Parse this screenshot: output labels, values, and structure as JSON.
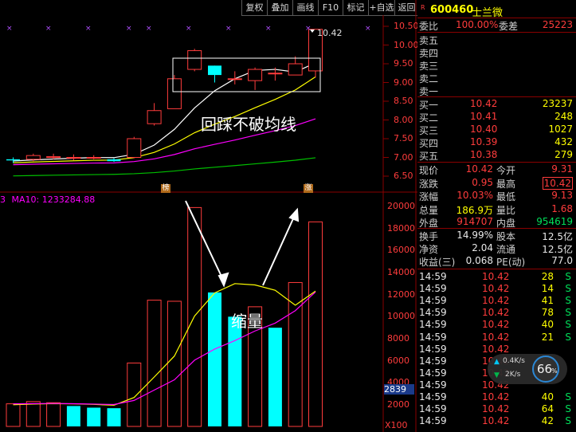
{
  "toolbar": {
    "buttons": [
      "复权",
      "叠加",
      "画线",
      "F10",
      "标记",
      "+自选",
      "返回"
    ],
    "close_icon": "close-icon"
  },
  "chart": {
    "price_axis": [
      "10.50",
      "10.00",
      "9.50",
      "9.00",
      "8.50",
      "8.00",
      "7.50",
      "7.00",
      "6.50"
    ],
    "last_price_label": "10.42",
    "annotation_top": "回踩不破均线",
    "badge_left": "榜",
    "badge_right": "涨",
    "ma_label": "MA10: 1233284.88",
    "ma_prefix": "3",
    "volume_axis": [
      "20000",
      "18000",
      "16000",
      "14000",
      "12000",
      "10000",
      "8000",
      "6000",
      "4000",
      "2000"
    ],
    "volume_marker": "2839",
    "volume_unit": "X100",
    "annotation_volume": "缩量"
  },
  "chart_data": {
    "type": "candlestick",
    "candles": [
      {
        "o": 6.95,
        "c": 6.92,
        "h": 7.0,
        "l": 6.85
      },
      {
        "o": 6.95,
        "c": 7.05,
        "h": 7.1,
        "l": 6.9
      },
      {
        "o": 7.02,
        "c": 7.02,
        "h": 7.1,
        "l": 6.95
      },
      {
        "o": 7.0,
        "c": 7.0,
        "h": 7.08,
        "l": 6.92
      },
      {
        "o": 7.0,
        "c": 7.0,
        "h": 7.06,
        "l": 6.95
      },
      {
        "o": 6.95,
        "c": 6.9,
        "h": 6.98,
        "l": 6.88
      },
      {
        "o": 7.0,
        "c": 7.5,
        "h": 7.55,
        "l": 6.98
      },
      {
        "o": 7.9,
        "c": 8.25,
        "h": 8.45,
        "l": 7.85
      },
      {
        "o": 8.3,
        "c": 9.1,
        "h": 9.2,
        "l": 8.3
      },
      {
        "o": 9.35,
        "c": 9.85,
        "h": 9.9,
        "l": 9.3
      },
      {
        "o": 9.45,
        "c": 9.2,
        "h": 9.45,
        "l": 9.0
      },
      {
        "o": 9.1,
        "c": 9.1,
        "h": 9.3,
        "l": 8.95
      },
      {
        "o": 9.05,
        "c": 9.35,
        "h": 9.4,
        "l": 8.8
      },
      {
        "o": 9.25,
        "c": 9.25,
        "h": 9.4,
        "l": 9.05
      },
      {
        "o": 9.2,
        "c": 9.5,
        "h": 9.7,
        "l": 9.2
      },
      {
        "o": 9.31,
        "c": 10.42,
        "h": 10.42,
        "l": 9.13
      }
    ],
    "volumes": [
      2100,
      2300,
      2200,
      1900,
      1750,
      1700,
      5800,
      11500,
      11400,
      19900,
      12200,
      10000,
      10900,
      9000,
      13100,
      18600
    ],
    "volume_up": [
      true,
      true,
      true,
      false,
      false,
      false,
      true,
      true,
      true,
      true,
      false,
      false,
      true,
      false,
      true,
      true
    ]
  },
  "quote": {
    "code_badge": "R",
    "code": "600460",
    "name": "士兰微",
    "weibi_label": "委比",
    "weibi": "100.00%",
    "weicha_label": "委差",
    "weicha": "25223",
    "sells": [
      "卖五",
      "卖四",
      "卖三",
      "卖二",
      "卖一"
    ],
    "buys": [
      {
        "label": "买一",
        "price": "10.42",
        "vol": "23237"
      },
      {
        "label": "买二",
        "price": "10.41",
        "vol": "248"
      },
      {
        "label": "买三",
        "price": "10.40",
        "vol": "1027"
      },
      {
        "label": "买四",
        "price": "10.39",
        "vol": "432"
      },
      {
        "label": "买五",
        "price": "10.38",
        "vol": "279"
      }
    ],
    "stats": [
      {
        "l1": "现价",
        "v1": "10.42",
        "l2": "今开",
        "v2": "9.31",
        "c1": "red",
        "c2": "red"
      },
      {
        "l1": "涨跌",
        "v1": "0.95",
        "l2": "最高",
        "v2": "10.42",
        "c1": "red",
        "c2": "red"
      },
      {
        "l1": "涨幅",
        "v1": "10.03%",
        "l2": "最低",
        "v2": "9.13",
        "c1": "red",
        "c2": "red"
      },
      {
        "l1": "总量",
        "v1": "186.9万",
        "l2": "量比",
        "v2": "1.68",
        "c1": "yel",
        "c2": "red"
      },
      {
        "l1": "外盘",
        "v1": "914707",
        "l2": "内盘",
        "v2": "954619",
        "c1": "red",
        "c2": "grn"
      }
    ],
    "stats2": [
      {
        "l1": "换手",
        "v1": "14.99%",
        "l2": "股本",
        "v2": "12.5亿"
      },
      {
        "l1": "净资",
        "v1": "2.04",
        "l2": "流通",
        "v2": "12.5亿"
      },
      {
        "l1": "收益(三)",
        "v1": "0.068",
        "l2": "PE(动)",
        "v2": "77.0"
      }
    ]
  },
  "ticks": [
    {
      "t": "14:59",
      "p": "10.42",
      "v": "28",
      "d": "S"
    },
    {
      "t": "14:59",
      "p": "10.42",
      "v": "14",
      "d": "S"
    },
    {
      "t": "14:59",
      "p": "10.42",
      "v": "41",
      "d": "S"
    },
    {
      "t": "14:59",
      "p": "10.42",
      "v": "78",
      "d": "S"
    },
    {
      "t": "14:59",
      "p": "10.42",
      "v": "40",
      "d": "S"
    },
    {
      "t": "14:59",
      "p": "10.42",
      "v": "21",
      "d": "S"
    },
    {
      "t": "14:59",
      "p": "10.42",
      "v": "",
      "d": ""
    },
    {
      "t": "14:59",
      "p": "10.42",
      "v": "",
      "d": ""
    },
    {
      "t": "14:59",
      "p": "10.42",
      "v": "",
      "d": ""
    },
    {
      "t": "14:59",
      "p": "10.42",
      "v": "",
      "d": ""
    },
    {
      "t": "14:59",
      "p": "10.42",
      "v": "40",
      "d": "S"
    },
    {
      "t": "14:59",
      "p": "10.42",
      "v": "64",
      "d": "S"
    },
    {
      "t": "14:59",
      "p": "10.42",
      "v": "42",
      "d": "S"
    }
  ],
  "speed_widget": {
    "up": "0.4K/s",
    "down": "2K/s",
    "percent": "66",
    "percent_sign": "%"
  },
  "colors": {
    "up": "#ff3c3c",
    "down": "#00ffff",
    "ma5": "#ffffff",
    "ma10": "#ffff00",
    "ma20": "#ff00ff",
    "ma60": "#00c000"
  }
}
